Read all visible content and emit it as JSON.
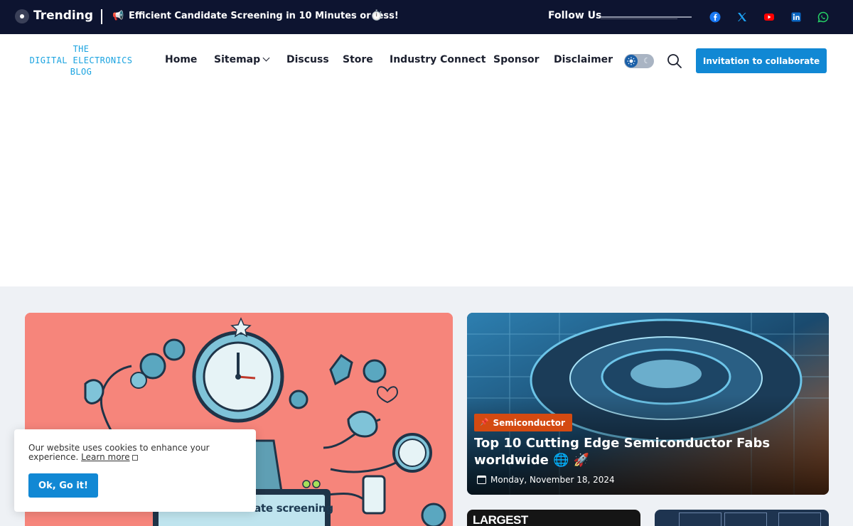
{
  "topbar": {
    "trending_label": "Trending",
    "trending_icon": "📢",
    "trending_headline": "Efficient Candidate Screening in 10 Minutes or less!",
    "trending_emoji": "⏱️",
    "follow_label": "Follow Us",
    "socials": [
      {
        "name": "facebook-icon",
        "color": "#1877f2"
      },
      {
        "name": "x-twitter-icon",
        "color": "#1da1f2"
      },
      {
        "name": "youtube-icon",
        "color": "#ff0000"
      },
      {
        "name": "linkedin-icon",
        "color": "#0a66c2"
      },
      {
        "name": "whatsapp-icon",
        "color": "#25d366"
      }
    ]
  },
  "nav": {
    "logo_line1": "THE",
    "logo_line2": "DIGITAL ELECTRONICS",
    "logo_line3": "BLOG",
    "items": [
      "Home",
      "Sitemap",
      "Discuss",
      "Store",
      "Industry Connect",
      "Sponsor",
      "Disclaimer"
    ],
    "collab_label": "Invitation to collaborate"
  },
  "main": {
    "big_card_screen_text": "Efficient candidate screening",
    "featured": {
      "category": "Semiconductor",
      "title": "Top 10 Cutting Edge Semiconductor Fabs worldwide 🌐 🚀",
      "date": "Monday, November 18, 2024"
    },
    "small_card_1_text": "LARGEST"
  },
  "cookie": {
    "text": "Our website uses cookies to enhance your experience.",
    "link_text": "Learn more",
    "button_label": "Ok, Go it!"
  },
  "colors": {
    "topbar_bg": "#0d1430",
    "accent_blue": "#1188d4",
    "category_orange": "#d44a11",
    "logo_blue": "#1aa3e0",
    "hero_salmon": "#f6857b"
  }
}
